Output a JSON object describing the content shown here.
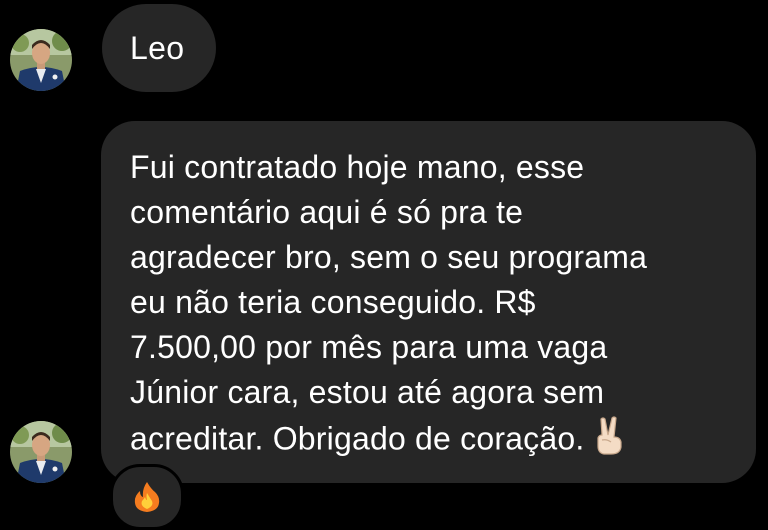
{
  "sender": {
    "name": "Leo",
    "avatar_icon": "profile-photo-icon"
  },
  "message": {
    "lines": [
      "Fui contratado hoje mano, esse",
      "comentário aqui é só pra te",
      "agradecer bro, sem o seu programa",
      "eu não teria conseguido. R$",
      "7.500,00 por mês para uma vaga",
      "Júnior cara, estou até agora sem",
      "acreditar. Obrigado de coração."
    ],
    "trailing_emoji_icon": "victory-hand-icon"
  },
  "reaction": {
    "icon": "fire-icon"
  },
  "colors": {
    "background": "#000000",
    "bubble": "#262626",
    "text": "#ffffff"
  }
}
